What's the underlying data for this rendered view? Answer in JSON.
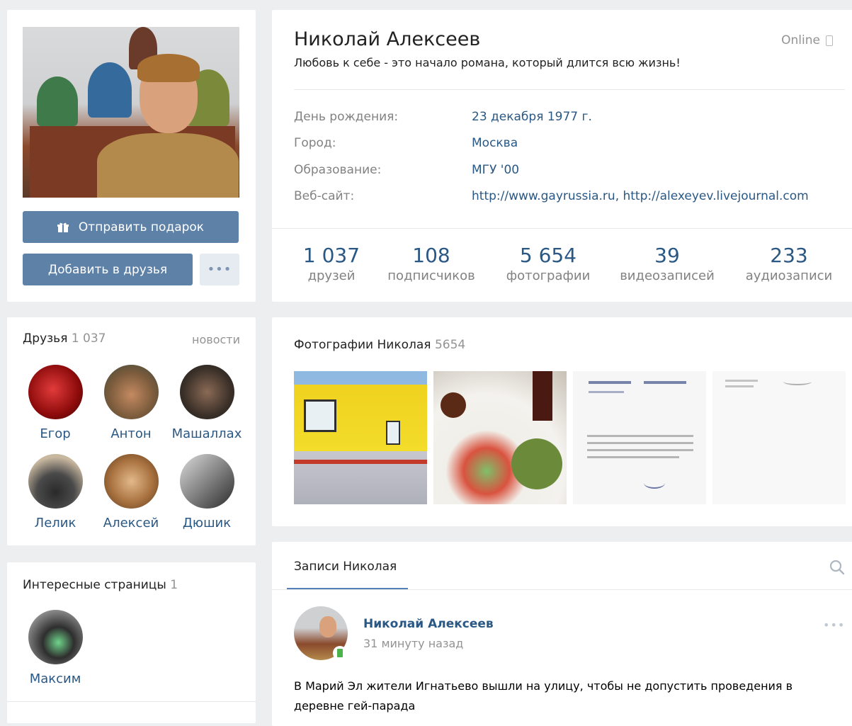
{
  "profile": {
    "name": "Николай Алексеев",
    "status": "Любовь к себе - это начало романа, который длится всю жизнь!",
    "online": "Online",
    "info": [
      {
        "label": "День рождения:",
        "value": "23 декабря 1977 г."
      },
      {
        "label": "Город:",
        "value": "Москва"
      },
      {
        "label": "Образование:",
        "value": "МГУ '00"
      },
      {
        "label": "Веб-сайт:",
        "value": "http://www.gayrussia.ru, http://alexeyev.livejournal.com"
      }
    ],
    "counters": [
      {
        "num": "1 037",
        "label": "друзей"
      },
      {
        "num": "108",
        "label": "подписчиков"
      },
      {
        "num": "5 654",
        "label": "фотографии"
      },
      {
        "num": "39",
        "label": "видеозаписей"
      },
      {
        "num": "233",
        "label": "аудиозаписи"
      }
    ]
  },
  "actions": {
    "gift": "Отправить подарок",
    "add_friend": "Добавить в друзья",
    "more": "•••"
  },
  "friends": {
    "title": "Друзья",
    "count": "1 037",
    "news_link": "новости",
    "items": [
      {
        "name": "Егор"
      },
      {
        "name": "Антон"
      },
      {
        "name": "Машаллах"
      },
      {
        "name": "Лелик"
      },
      {
        "name": "Алексей"
      },
      {
        "name": "Дюшик"
      }
    ]
  },
  "interesting": {
    "title": "Интересные страницы",
    "count": "1",
    "items": [
      {
        "name": "Максим"
      }
    ]
  },
  "photos": {
    "title": "Фотографии Николая",
    "count": "5654"
  },
  "wall": {
    "tab": "Записи Николая",
    "post": {
      "author": "Николай Алексеев",
      "time": "31 минуту назад",
      "text_line1": "В Марий Эл жители Игнатьево вышли на улицу, чтобы не допустить проведения в",
      "text_line2": "деревне гей-парада",
      "menu": "•••"
    }
  },
  "colors": {
    "accent": "#2a5885",
    "button": "#5e81a8",
    "background": "#edeef0"
  }
}
